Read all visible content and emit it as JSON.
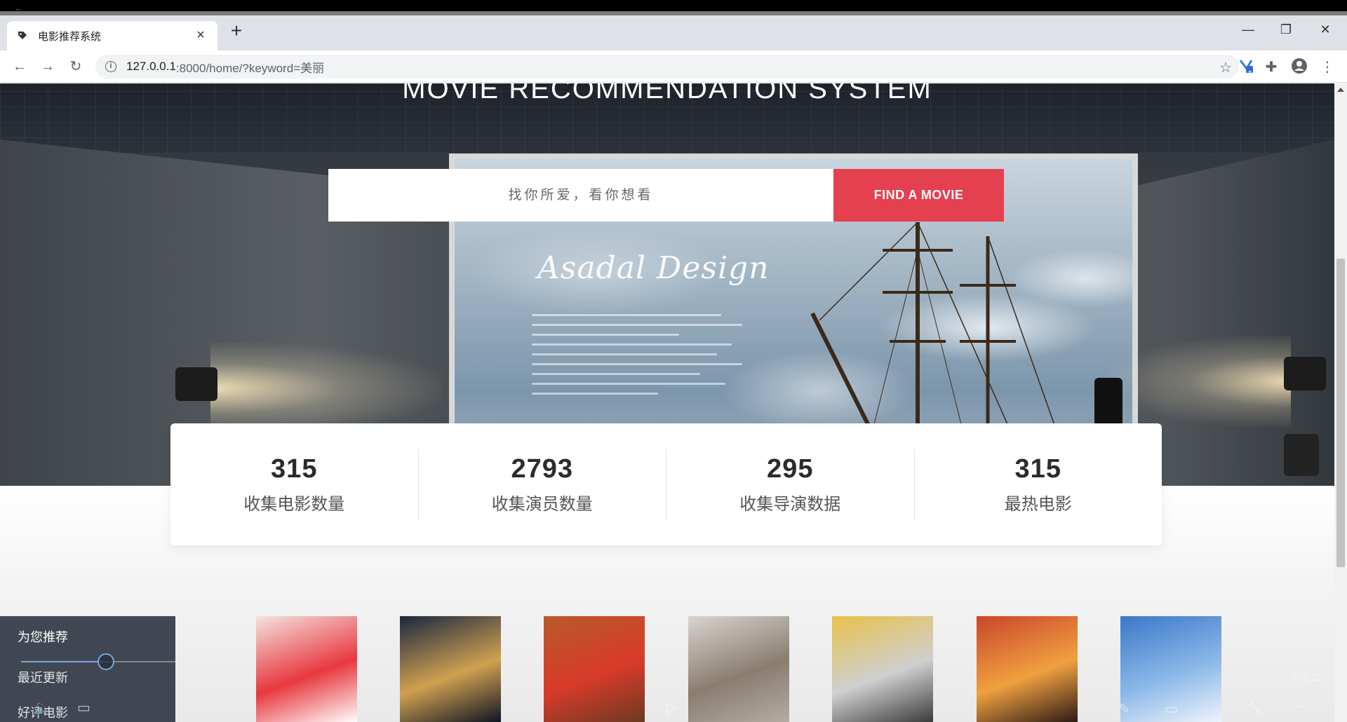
{
  "browser": {
    "tab_title": "电影推荐系统",
    "tab_close": "×",
    "new_tab": "+",
    "url_host": "127.0.0.1",
    "url_path": ":8000/home/?keyword=美丽",
    "info_icon": "i",
    "extension_badge": "1",
    "window_controls": {
      "minimize": "—",
      "restore": "❐",
      "close": "✕"
    }
  },
  "hero": {
    "title": "MOVIE RECOMMENDATION SYSTEM",
    "brand_script": "Asadal Design"
  },
  "search": {
    "placeholder": "找你所爱，看你想看",
    "button_label": "FIND A MOVIE"
  },
  "stats": [
    {
      "value": "315",
      "label": "收集电影数量"
    },
    {
      "value": "2793",
      "label": "收集演员数量"
    },
    {
      "value": "295",
      "label": "收集导演数据"
    },
    {
      "value": "315",
      "label": "最热电影"
    }
  ],
  "float_menu": {
    "items": [
      "为您推荐",
      "最近更新",
      "好评电影"
    ],
    "slider_level": 0.55
  },
  "player": {
    "time": "0:01:22"
  },
  "posters": [
    {
      "name": "poster-1",
      "colors": [
        "#f3e3df",
        "#e8383f",
        "#ffffff"
      ]
    },
    {
      "name": "poster-2",
      "colors": [
        "#1a2740",
        "#d0a050",
        "#0d1422"
      ]
    },
    {
      "name": "poster-3",
      "colors": [
        "#b85a2a",
        "#d83a2a",
        "#6b3a22"
      ]
    },
    {
      "name": "poster-4",
      "colors": [
        "#d9d4cf",
        "#8a7d70",
        "#b4aca3"
      ]
    },
    {
      "name": "poster-5",
      "colors": [
        "#e8c24a",
        "#cfcfcf",
        "#3a3a3a"
      ]
    },
    {
      "name": "poster-6",
      "colors": [
        "#c9462a",
        "#f0a040",
        "#2a1a14"
      ]
    },
    {
      "name": "poster-7",
      "colors": [
        "#3a78c8",
        "#8bb8e8",
        "#f0f4fa"
      ]
    }
  ],
  "colors": {
    "accent": "#e5404f",
    "chrome_bg": "#dee1e6"
  }
}
